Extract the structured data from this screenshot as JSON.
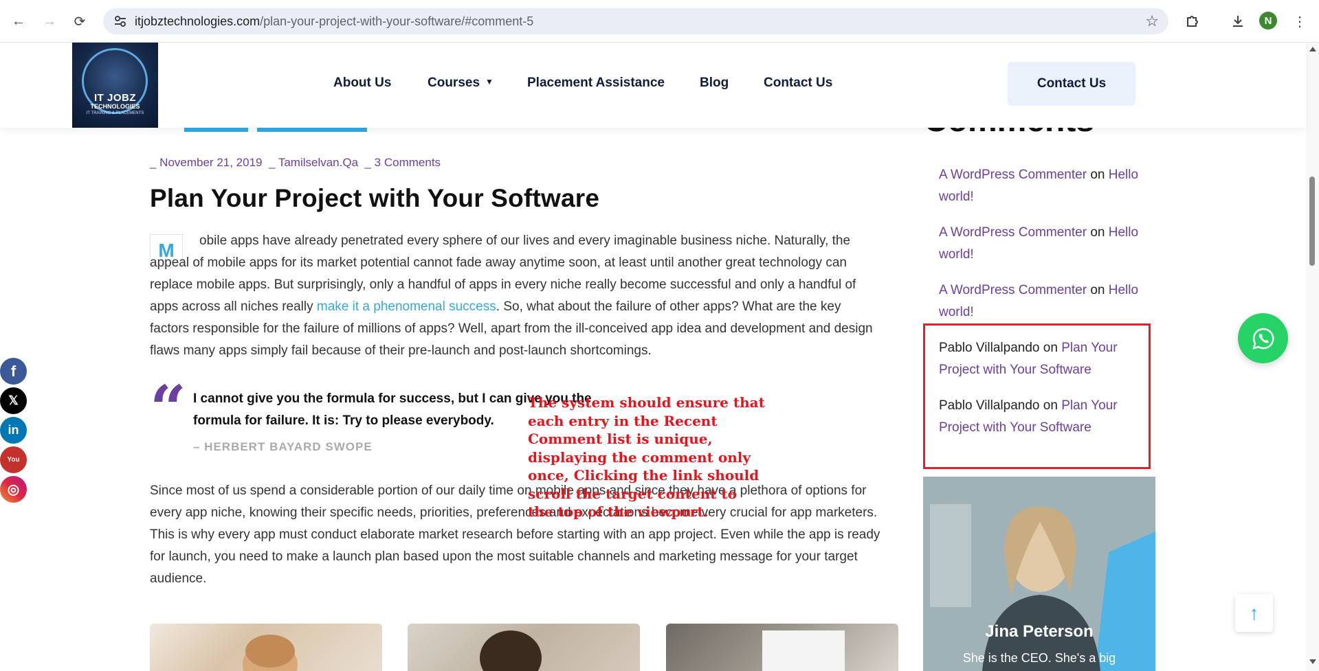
{
  "browser": {
    "url_domain": "itjobztechnologies.com",
    "url_path": "/plan-your-project-with-your-software/#comment-5",
    "profile_initial": "N"
  },
  "header": {
    "logo_line1": "IT JOBZ",
    "logo_line2": "TECHNOLOGIES",
    "logo_line3": "IT TRAINING & PLACEMENTS",
    "nav": [
      {
        "label": "About Us"
      },
      {
        "label": "Courses"
      },
      {
        "label": "Placement Assistance"
      },
      {
        "label": "Blog"
      },
      {
        "label": "Contact Us"
      }
    ],
    "contact_button": "Contact Us"
  },
  "post": {
    "date": "_ November 21, 2019",
    "author": "_ Tamilselvan.Qa",
    "comments": "_ 3 Comments",
    "title": "Plan Your Project with Your Software",
    "dropcap": "M",
    "para1_start": "obile apps have already penetrated every sphere of our lives and every imaginable business niche. Naturally, the appeal of mobile apps for its market potential cannot fade away anytime soon, at least until another great technology can replace mobile apps. But surprisingly, only a handful of apps in every niche really become successful and only a handful of apps across all niches really ",
    "para1_link": "make it a phenomenal success",
    "para1_end": ". So, what about the failure of other apps? What are the key factors responsible for the failure of millions of apps? Well, apart from the ill-conceived app idea and development and design flaws many apps simply fail because of their pre-launch and post-launch shortcomings.",
    "quote": "I cannot give you the formula for success, but I can give you the formula for failure. It is: Try to please everybody.",
    "quote_author": "– HERBERT BAYARD SWOPE",
    "para2": "Since most of us spend a considerable portion of our daily time on mobile apps and since they have a plethora of options for every app niche, knowing their specific needs, priorities, preferences and expectations become very crucial for app marketers. This is why every app must conduct elaborate market research before starting with an app project. Even while the app is ready for launch, you need to make a launch plan based upon the most suitable channels and marketing message for your target audience."
  },
  "annotation": "The system should ensure that each entry in the Recent Comment list is unique, displaying the comment only once, Clicking the link should scroll the target content to the top of the viewport.",
  "sidebar": {
    "heading": "Comments",
    "on_word": "on",
    "recent_comments": [
      {
        "author": "A WordPress Commenter",
        "post": "Hello world!"
      },
      {
        "author": "A WordPress Commenter",
        "post": "Hello world!"
      },
      {
        "author": "A WordPress Commenter",
        "post": "Hello world!"
      },
      {
        "author": "Pablo Villalpando",
        "post": "Plan Your Project with Your Software"
      },
      {
        "author": "Pablo Villalpando",
        "post": "Plan Your Project with Your Software"
      }
    ],
    "person_name": "Jina Peterson",
    "person_sub": "She is the CEO. She's a big"
  },
  "social": [
    {
      "icon": "facebook-icon",
      "glyph": "f",
      "color": "#3b5998"
    },
    {
      "icon": "x-icon",
      "glyph": "𝕏",
      "color": "#000000"
    },
    {
      "icon": "linkedin-icon",
      "glyph": "in",
      "color": "#0077b5"
    },
    {
      "icon": "youtube-icon",
      "glyph": "You",
      "color": "#c4302b"
    },
    {
      "icon": "instagram-icon",
      "glyph": "◎",
      "color": "#d6249f"
    }
  ]
}
